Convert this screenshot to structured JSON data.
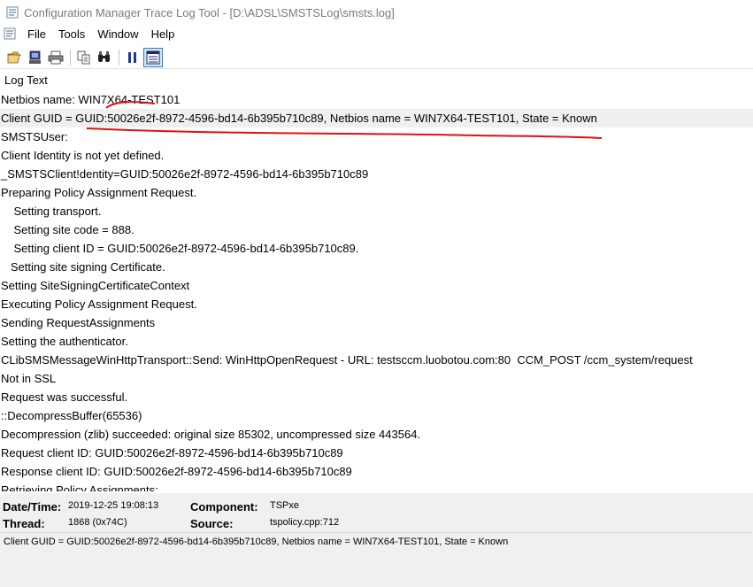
{
  "window": {
    "title": "Configuration Manager Trace Log Tool - [D:\\ADSL\\SMSTSLog\\smsts.log]"
  },
  "menu": {
    "items": [
      "File",
      "Tools",
      "Window",
      "Help"
    ]
  },
  "toolbar": {
    "buttons": [
      "open-icon",
      "print-server-icon",
      "print-icon",
      "copy-icon",
      "find-icon",
      "pause-icon",
      "highlight-icon"
    ]
  },
  "log": {
    "column_header": "Log Text",
    "rows": [
      "Netbios name: WIN7X64-TEST101",
      "Client GUID = GUID:50026e2f-8972-4596-bd14-6b395b710c89, Netbios name = WIN7X64-TEST101, State = Known",
      "SMSTSUser:",
      "Client Identity is not yet defined.",
      "_SMSTSClient!dentity=GUID:50026e2f-8972-4596-bd14-6b395b710c89",
      "Preparing Policy Assignment Request.",
      "    Setting transport.",
      "    Setting site code = 888.",
      "    Setting client ID = GUID:50026e2f-8972-4596-bd14-6b395b710c89.",
      "   Setting site signing Certificate.",
      "Setting SiteSigningCertificateContext",
      "Executing Policy Assignment Request.",
      "Sending RequestAssignments",
      "Setting the authenticator.",
      "CLibSMSMessageWinHttpTransport::Send: WinHttpOpenRequest - URL: testsccm.luobotou.com:80  CCM_POST /ccm_system/request",
      "Not in SSL",
      "Request was successful.",
      "::DecompressBuffer(65536)",
      "Decompression (zlib) succeeded: original size 85302, uncompressed size 443564.",
      "Request client ID: GUID:50026e2f-8972-4596-bd14-6b395b710c89",
      "Response client ID: GUID:50026e2f-8972-4596-bd14-6b395b710c89",
      "Retrieving Policy Assignments:"
    ],
    "selected_index": 1
  },
  "details": {
    "datetime_label": "Date/Time:",
    "datetime_value": "2019-12-25 19:08:13",
    "component_label": "Component:",
    "component_value": "TSPxe",
    "thread_label": "Thread:",
    "thread_value": "1868 (0x74C)",
    "source_label": "Source:",
    "source_value": "tspolicy.cpp:712",
    "message": "Client GUID = GUID:50026e2f-8972-4596-bd14-6b395b710c89, Netbios name = WIN7X64-TEST101, State = Known"
  },
  "colors": {
    "annotation_red": "#e01010",
    "selected_row": "#efefef",
    "details_bg": "#f0f0f0"
  }
}
